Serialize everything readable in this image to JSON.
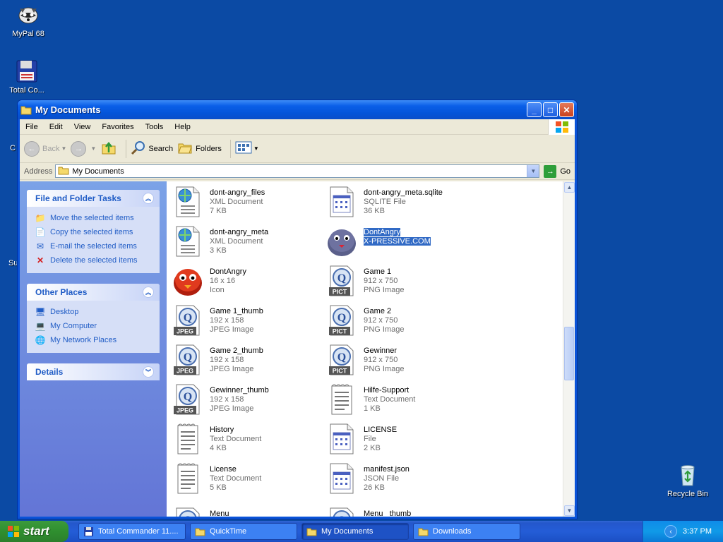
{
  "desktop": {
    "icons": [
      {
        "label": "MyPal 68"
      },
      {
        "label": "Total Co..."
      },
      {
        "label": "Recycle Bin"
      }
    ],
    "partial_labels": [
      "C",
      "Su"
    ]
  },
  "window": {
    "title": "My Documents",
    "menu": [
      "File",
      "Edit",
      "View",
      "Favorites",
      "Tools",
      "Help"
    ],
    "toolbar": {
      "back": "Back",
      "search": "Search",
      "folders": "Folders"
    },
    "address": {
      "label": "Address",
      "value": "My Documents",
      "go": "Go"
    },
    "taskpane": {
      "file_tasks": {
        "title": "File and Folder Tasks",
        "items": [
          "Move the selected items",
          "Copy the selected items",
          "E-mail the selected items",
          "Delete the selected items"
        ]
      },
      "other_places": {
        "title": "Other Places",
        "items": [
          "Desktop",
          "My Computer",
          "My Network Places"
        ]
      },
      "details": {
        "title": "Details"
      }
    },
    "files": [
      {
        "name": "dont-angry_files",
        "l2": "XML Document",
        "l3": "7 KB",
        "icon": "xml-document-icon"
      },
      {
        "name": "dont-angry_meta.sqlite",
        "l2": "SQLITE File",
        "l3": "36 KB",
        "icon": "generic-file-icon"
      },
      {
        "name": "dont-angry_meta",
        "l2": "XML Document",
        "l3": "3 KB",
        "icon": "xml-document-icon"
      },
      {
        "name": "DontAngry",
        "l2": "X-PRESSIVE.COM",
        "l3": "",
        "icon": "dontangry-app-icon",
        "selected": true
      },
      {
        "name": "DontAngry",
        "l2": "16 x 16",
        "l3": "Icon",
        "icon": "dontangry-red-icon"
      },
      {
        "name": "Game 1",
        "l2": "912 x 750",
        "l3": "PNG Image",
        "icon": "pict-image-icon"
      },
      {
        "name": "Game 1_thumb",
        "l2": "192 x 158",
        "l3": "JPEG Image",
        "icon": "jpeg-image-icon"
      },
      {
        "name": "Game 2",
        "l2": "912 x 750",
        "l3": "PNG Image",
        "icon": "pict-image-icon"
      },
      {
        "name": "Game 2_thumb",
        "l2": "192 x 158",
        "l3": "JPEG Image",
        "icon": "jpeg-image-icon"
      },
      {
        "name": "Gewinner",
        "l2": "912 x 750",
        "l3": "PNG Image",
        "icon": "pict-image-icon"
      },
      {
        "name": "Gewinner_thumb",
        "l2": "192 x 158",
        "l3": "JPEG Image",
        "icon": "jpeg-image-icon"
      },
      {
        "name": "Hilfe-Support",
        "l2": "Text Document",
        "l3": "1 KB",
        "icon": "text-document-icon"
      },
      {
        "name": "History",
        "l2": "Text Document",
        "l3": "4 KB",
        "icon": "text-document-icon"
      },
      {
        "name": "LICENSE",
        "l2": "File",
        "l3": "2 KB",
        "icon": "generic-file-icon"
      },
      {
        "name": "License",
        "l2": "Text Document",
        "l3": "5 KB",
        "icon": "text-document-icon"
      },
      {
        "name": "manifest.json",
        "l2": "JSON File",
        "l3": "26 KB",
        "icon": "generic-file-icon"
      },
      {
        "name": "Menu",
        "l2": "",
        "l3": "",
        "icon": "jpeg-image-icon"
      },
      {
        "name": "Menu _thumb",
        "l2": "",
        "l3": "",
        "icon": "jpeg-image-icon"
      }
    ]
  },
  "taskbar": {
    "start": "start",
    "tasks": [
      "Total Commander 11....",
      "QuickTime",
      "My Documents",
      "Downloads"
    ],
    "clock": "3:37 PM"
  },
  "colors": {
    "desktop": "#0b4aa4",
    "selection": "#316ac5",
    "link": "#215dc6"
  }
}
